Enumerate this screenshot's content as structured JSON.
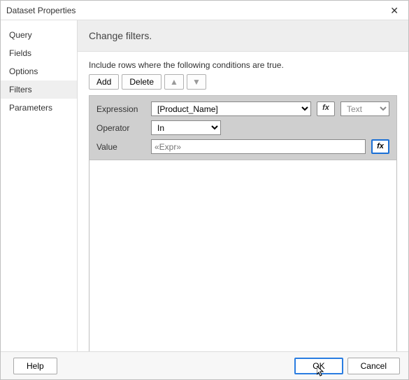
{
  "title": "Dataset Properties",
  "close_glyph": "✕",
  "sidebar": {
    "items": [
      {
        "label": "Query"
      },
      {
        "label": "Fields"
      },
      {
        "label": "Options"
      },
      {
        "label": "Filters"
      },
      {
        "label": "Parameters"
      }
    ],
    "active_index": 3
  },
  "heading": "Change filters.",
  "instruction": "Include rows where the following conditions are true.",
  "buttons": {
    "add": "Add",
    "delete": "Delete",
    "up": "▲",
    "down": "▼"
  },
  "filter": {
    "expression_label": "Expression",
    "expression_value": "[Product_Name]",
    "fx_label": "fx",
    "type_label": "Text",
    "operator_label": "Operator",
    "operator_value": "In",
    "value_label": "Value",
    "value_placeholder": "«Expr»"
  },
  "footer": {
    "help": "Help",
    "ok": "OK",
    "cancel": "Cancel"
  },
  "cursor_glyph": "↖"
}
